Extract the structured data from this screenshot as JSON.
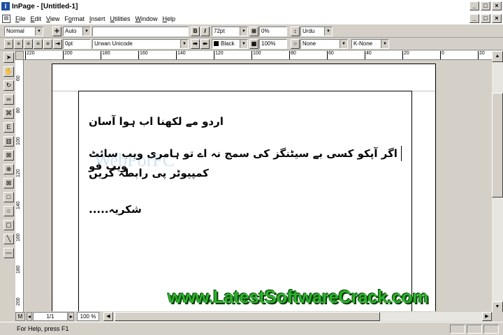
{
  "window": {
    "title": "InPage - [Untitled-1]",
    "app_icon": "I"
  },
  "window_controls": {
    "minimize": "_",
    "maximize": "□",
    "close": "×"
  },
  "menu": [
    {
      "acc": "F",
      "rest": "ile"
    },
    {
      "acc": "E",
      "rest": "dit"
    },
    {
      "acc": "V",
      "rest": "iew"
    },
    {
      "pre": "F",
      "acc": "o",
      "rest": "rmat"
    },
    {
      "acc": "I",
      "rest": "nsert"
    },
    {
      "acc": "U",
      "rest": "tilities"
    },
    {
      "acc": "W",
      "rest": "indow"
    },
    {
      "acc": "H",
      "rest": "elp"
    }
  ],
  "toolbar1": {
    "style": "Normal",
    "leading": "Auto",
    "bold": "B",
    "italic": "I",
    "font_size": "72pt",
    "tracking": "0%",
    "language": "Urdu"
  },
  "toolbar2": {
    "indent": "0pt",
    "font": "Urwan Unicode",
    "color": "Black",
    "shade": "100%",
    "style_none": "None",
    "kashida": "K-None"
  },
  "ruler_h": [
    "220",
    "200",
    "180",
    "160",
    "140",
    "120",
    "100",
    "80",
    "60",
    "40",
    "20",
    "0",
    "20"
  ],
  "ruler_v": [
    "60",
    "80",
    "100",
    "120",
    "140",
    "160",
    "180",
    "200"
  ],
  "document": {
    "line1": "اردو مے لکھنا اب ہوا آسان",
    "line2": "اگر آپکو کسی بے سیٹنگز کی سمج نہ اے تو ہامری ویب سائٹ ویب فو",
    "line3": "کمپیوٹر پی رابطہ کریں",
    "line4": "شکریہ.....",
    "faint_watermark": "WebForPC",
    "watermark": "www.LatestSoftwareCrack.com"
  },
  "bottom": {
    "layout_btn": "M",
    "page_num": "1/1",
    "zoom": "100 %"
  },
  "status": {
    "help_text": "For Help, press F1"
  }
}
